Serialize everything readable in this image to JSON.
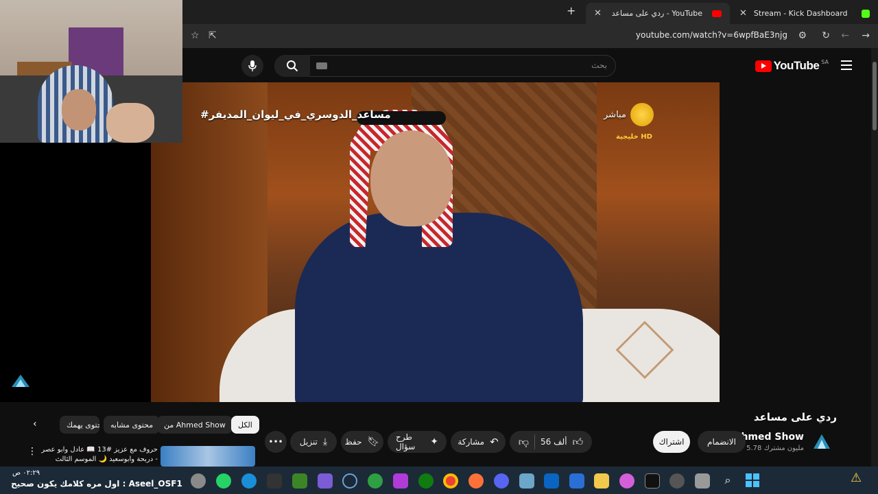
{
  "browser": {
    "tabs": [
      {
        "title": "ردي على مساعد - YouTube",
        "active": true
      },
      {
        "title": "Stream - Kick Dashboard",
        "active": false
      }
    ],
    "url": "youtube.com/watch?v=6wpfBaE3njg"
  },
  "youtube": {
    "search_placeholder": "بحث",
    "logo_text": "YouTube",
    "country_code": "SA"
  },
  "video": {
    "overlay_hashtag": "#مساعد_الدوسري_في_ليوان_المديفر",
    "channel_logo_label": "مباشر",
    "channel_logo_sub": "خليجية HD"
  },
  "watch": {
    "title": "ردي على مساعد",
    "channel_name": "Ahmed Show",
    "subscribers": "5.78 مليون مشترك",
    "join_label": "الانضمام",
    "subscribe_label": "اشتراك",
    "likes": "56 ألف",
    "share_label": "مشاركة",
    "ask_label": "طرح سؤال",
    "save_label": "حفظ",
    "download_label": "تنزيل"
  },
  "chips": {
    "all": "الكل",
    "from": "من Ahmed Show",
    "similar": "محتوى مشابه",
    "related": "محتوى يهمك"
  },
  "recommendation": {
    "title": "حروف مع عزيز #13 📖 عادل وابو عصر - دربحة وابوسعيد 🌙 الموسم الثالث"
  },
  "taskbar": {
    "clock": "٠٢:٢٩ ص",
    "ticker": "اول مره كلامك يكون صحيح : Aseel_OSF1"
  },
  "colors": {
    "youtube_red": "#ff0000",
    "kick_green": "#53fc18",
    "windows_blue": "#4cc2ff"
  }
}
